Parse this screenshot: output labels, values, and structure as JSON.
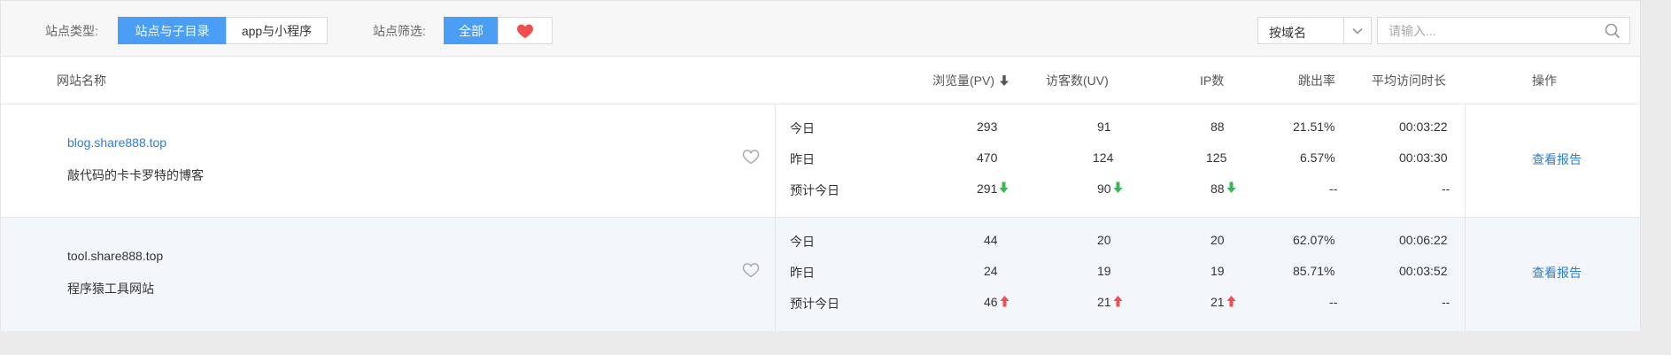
{
  "filters": {
    "site_type_label": "站点类型:",
    "site_type_options": [
      "站点与子目录",
      "app与小程序"
    ],
    "site_filter_label": "站点筛选:",
    "site_filter_options": [
      "全部"
    ],
    "favorite_icon": "heart-filled-icon",
    "sort_select": {
      "value": "按域名"
    },
    "search": {
      "placeholder": "请输入...",
      "value": ""
    }
  },
  "table": {
    "headers": {
      "name": "网站名称",
      "pv": "浏览量(PV)",
      "uv": "访客数(UV)",
      "ip": "IP数",
      "bounce": "跳出率",
      "duration": "平均访问时长",
      "action": "操作"
    },
    "rows": [
      {
        "domain": "blog.share888.top",
        "description": "敲代码的卡卡罗特的博客",
        "favorited": false,
        "stats": [
          {
            "label": "今日",
            "pv": "293",
            "uv": "91",
            "ip": "88",
            "bounce": "21.51%",
            "duration": "00:03:22"
          },
          {
            "label": "昨日",
            "pv": "470",
            "uv": "124",
            "ip": "125",
            "bounce": "6.57%",
            "duration": "00:03:30"
          },
          {
            "label": "预计今日",
            "pv": "291",
            "uv": "90",
            "ip": "88",
            "bounce": "--",
            "duration": "--",
            "trend": "down"
          }
        ],
        "action": "查看报告"
      },
      {
        "domain": "tool.share888.top",
        "description": "程序猿工具网站",
        "favorited": false,
        "stats": [
          {
            "label": "今日",
            "pv": "44",
            "uv": "20",
            "ip": "20",
            "bounce": "62.07%",
            "duration": "00:06:22"
          },
          {
            "label": "昨日",
            "pv": "24",
            "uv": "19",
            "ip": "19",
            "bounce": "85.71%",
            "duration": "00:03:52"
          },
          {
            "label": "预计今日",
            "pv": "46",
            "uv": "21",
            "ip": "21",
            "bounce": "--",
            "duration": "--",
            "trend": "up"
          }
        ],
        "action": "查看报告"
      }
    ]
  },
  "colors": {
    "accent": "#4a9ff5",
    "link": "#2b7fd4",
    "trend_down": "#3cb853",
    "trend_up": "#f0504d",
    "favorite": "#f0504d",
    "row_alt_bg": "#f3f7fc"
  }
}
